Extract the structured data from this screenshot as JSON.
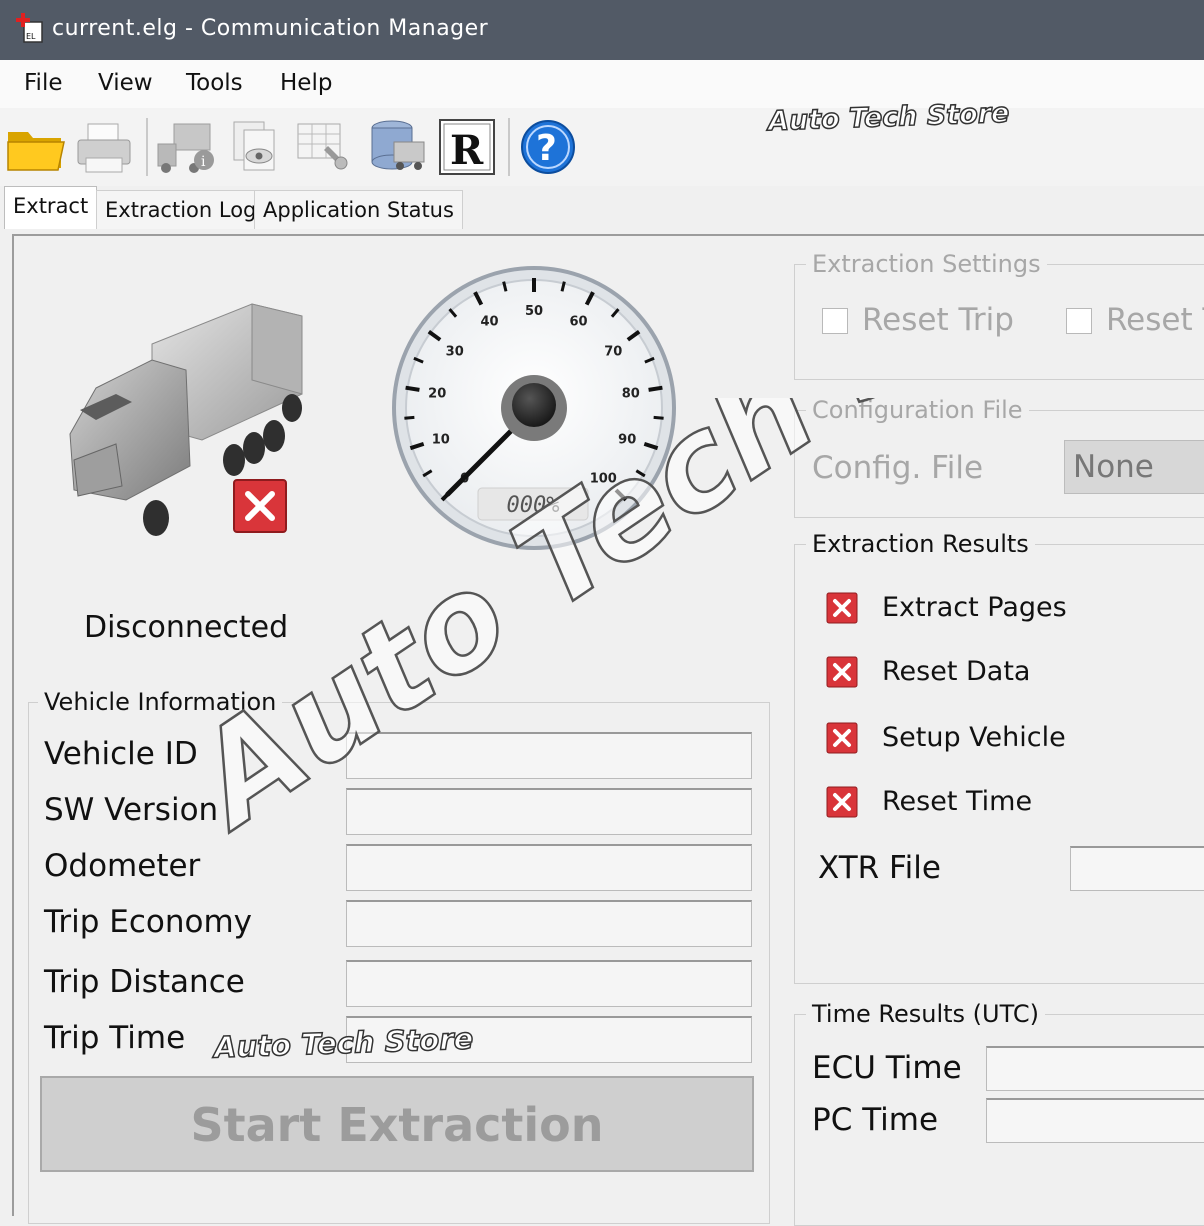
{
  "window": {
    "title": "current.elg - Communication Manager"
  },
  "menu": [
    "File",
    "View",
    "Tools",
    "Help"
  ],
  "toolbar": {
    "buttons": [
      "open-folder-icon",
      "print-icon",
      "truck-info-icon",
      "view-documents-icon",
      "table-settings-icon",
      "truck-database-icon",
      "r-icon",
      "help-icon"
    ]
  },
  "watermark": {
    "small_text": "Auto Tech Store",
    "big_text": "Auto Tech Store"
  },
  "tabs": [
    "Extract",
    "Extraction Log",
    "Application Status"
  ],
  "connection": {
    "status": "Disconnected"
  },
  "gauge": {
    "ticks": [
      "0",
      "10",
      "20",
      "30",
      "40",
      "50",
      "60",
      "70",
      "80",
      "90",
      "100"
    ],
    "readout": "000%",
    "value_percent": 0
  },
  "vehicle_info": {
    "title": "Vehicle Information",
    "rows": [
      {
        "label": "Vehicle ID",
        "value": ""
      },
      {
        "label": "SW Version",
        "value": ""
      },
      {
        "label": "Odometer",
        "value": ""
      },
      {
        "label": "Trip Economy",
        "value": ""
      },
      {
        "label": "Trip Distance",
        "value": ""
      },
      {
        "label": "Trip Time",
        "value": ""
      }
    ]
  },
  "start_button": {
    "label": "Start Extraction"
  },
  "extraction_settings": {
    "title": "Extraction Settings",
    "checkboxes": [
      {
        "label": "Reset Trip",
        "checked": false
      },
      {
        "label": "Reset T",
        "checked": false
      }
    ]
  },
  "config_file": {
    "title": "Configuration File",
    "label": "Config. File",
    "value": "None"
  },
  "extraction_results": {
    "title": "Extraction Results",
    "items": [
      "Extract Pages",
      "Reset Data",
      "Setup Vehicle",
      "Reset Time"
    ],
    "xtr_label": "XTR File",
    "xtr_value": ""
  },
  "time_results": {
    "title": "Time Results (UTC)",
    "ecu_label": "ECU Time",
    "ecu_value": "",
    "pc_label": "PC Time",
    "pc_value": ""
  },
  "colors": {
    "titlebar": "#525a66",
    "error_red": "#d9353a",
    "help_blue": "#1e73d8"
  }
}
